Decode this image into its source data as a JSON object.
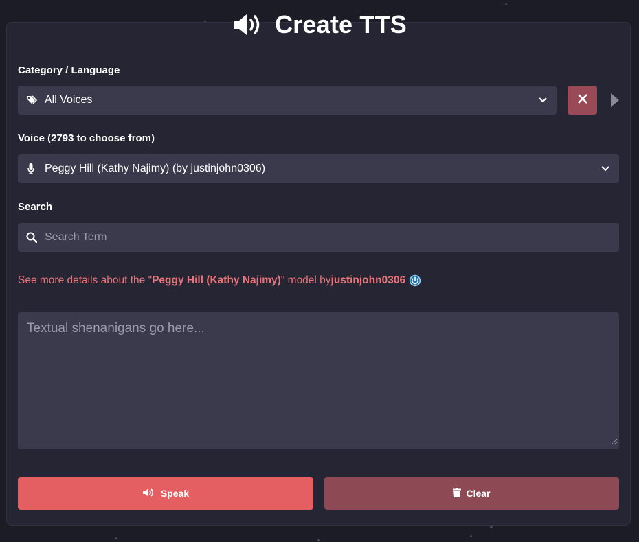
{
  "header": {
    "title": "Create TTS",
    "icon": "speaker-icon"
  },
  "category": {
    "label": "Category / Language",
    "selected": "All Voices",
    "icon": "tags-icon"
  },
  "voice": {
    "label": "Voice (2793 to choose from)",
    "selected": "Peggy Hill (Kathy Najimy) (by justinjohn0306)",
    "icon": "microphone-icon"
  },
  "search": {
    "label": "Search",
    "placeholder": "Search Term",
    "value": ""
  },
  "details": {
    "prefix": "See more details about the \"",
    "model_name": "Peggy Hill (Kathy Najimy)",
    "middle": "\" model by ",
    "author": "justinjohn0306"
  },
  "text_input": {
    "placeholder": "Textual shenanigans go here...",
    "value": ""
  },
  "buttons": {
    "speak": "Speak",
    "clear": "Clear"
  },
  "colors": {
    "background": "#1c1c27",
    "panel": "#252533",
    "field": "#3a3a4c",
    "accent": "#e35f62",
    "accent_dark": "#8d4a55",
    "link": "#e7747a"
  }
}
